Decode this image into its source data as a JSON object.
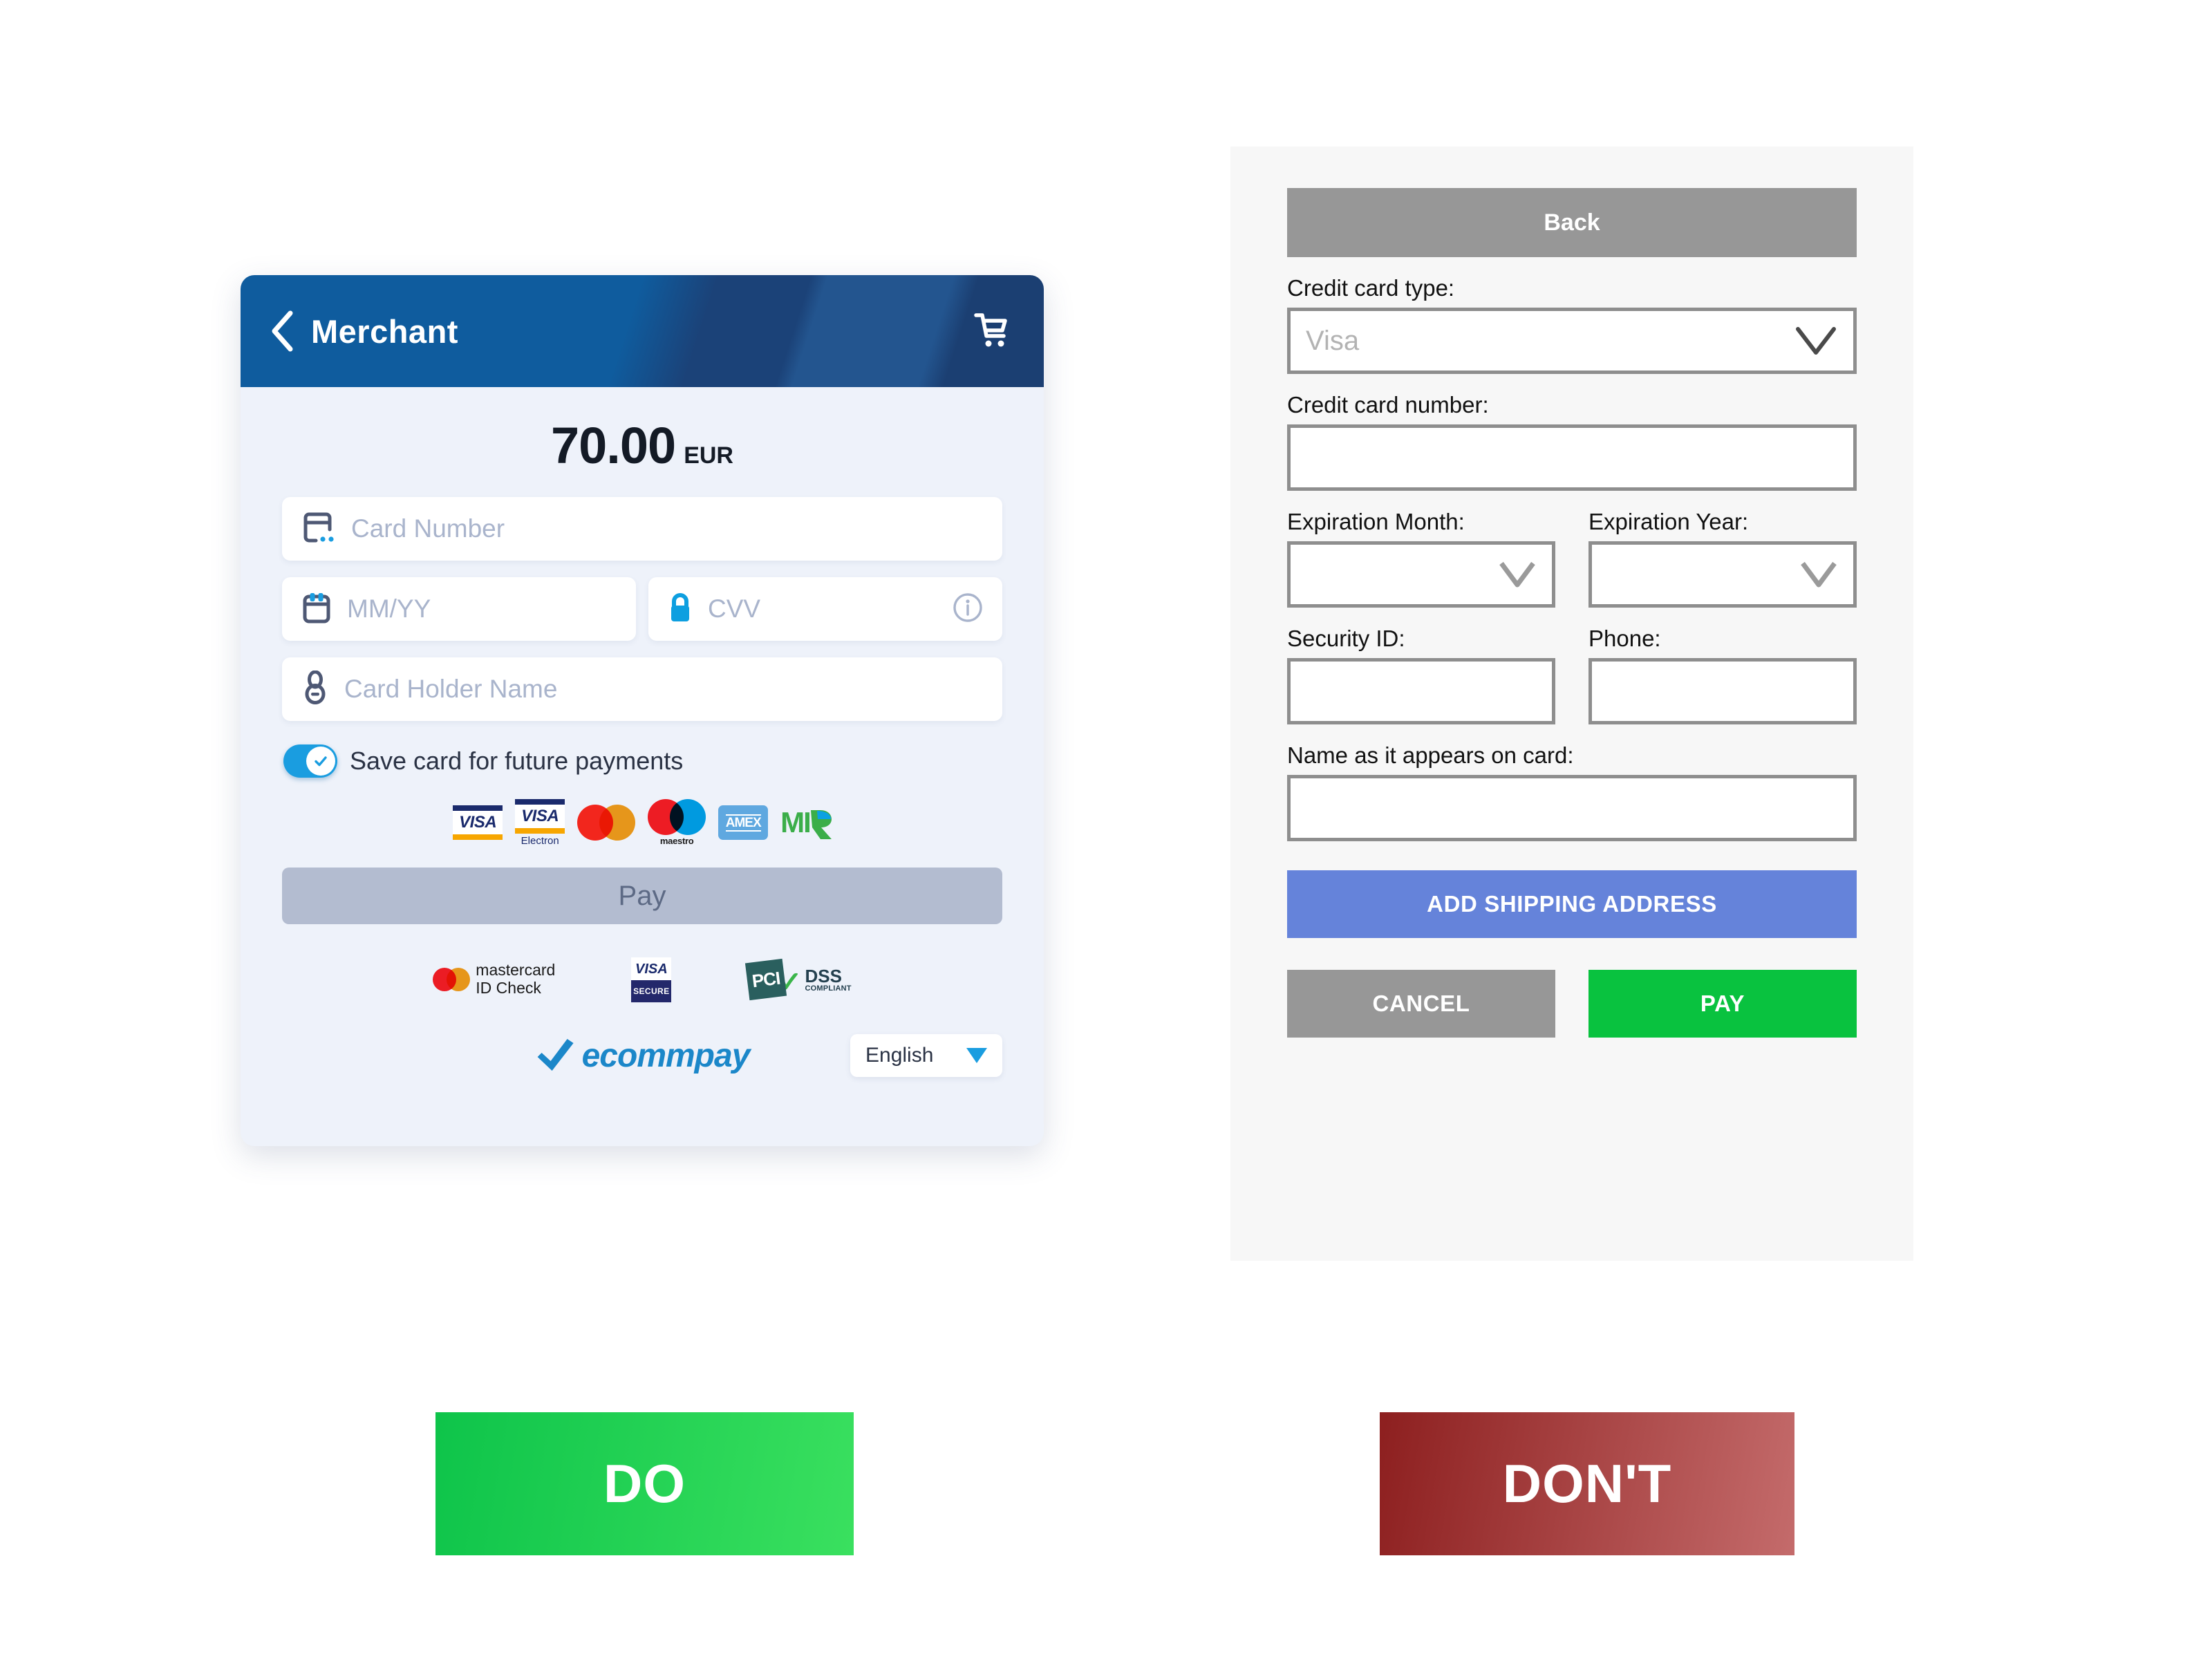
{
  "do_panel": {
    "header": {
      "back_icon": "chevron-left-icon",
      "merchant_title": "Merchant",
      "cart_icon": "shopping-cart-icon"
    },
    "amount": {
      "value": "70.00",
      "currency": "EUR"
    },
    "fields": [
      {
        "icon": "credit-card-icon",
        "placeholder": "Card Number",
        "value": ""
      },
      {
        "icon": "calendar-icon",
        "placeholder": "MM/YY",
        "value": ""
      },
      {
        "icon": "lock-icon",
        "placeholder": "CVV",
        "value": "",
        "trailing_icon": "info-circle-icon"
      },
      {
        "icon": "person-icon",
        "placeholder": "Card Holder Name",
        "value": ""
      }
    ],
    "save_card": {
      "label": "Save card for future payments",
      "checked": true,
      "check_icon": "check-icon"
    },
    "accepted_brands": [
      {
        "name": "visa-logo",
        "label": "VISA",
        "sub": ""
      },
      {
        "name": "visa-electron-logo",
        "label": "VISA",
        "sub": "Electron"
      },
      {
        "name": "mastercard-logo",
        "label": "",
        "sub": ""
      },
      {
        "name": "maestro-logo",
        "label": "",
        "sub": "maestro"
      },
      {
        "name": "amex-logo",
        "label": "AMEX",
        "sub": ""
      },
      {
        "name": "mir-logo",
        "label": "MI",
        "sub": ""
      }
    ],
    "pay_button_label": "Pay",
    "trust_badges": {
      "mastercard_idcheck_line1": "mastercard",
      "mastercard_idcheck_line2": "ID Check",
      "visa_secure_top": "VISA",
      "visa_secure_bottom": "SECURE",
      "pci_tile": "PCI",
      "pci_dss": "DSS",
      "pci_compliant": "COMPLIANT"
    },
    "footer": {
      "brand": "ecommpay",
      "brand_mark": "checkmark-logo-icon",
      "language_value": "English",
      "language_caret_icon": "caret-down-icon"
    }
  },
  "dont_panel": {
    "back_button_label": "Back",
    "fields": [
      {
        "label": "Credit card type:",
        "type": "select",
        "value": "Visa",
        "caret_icon": "chevron-down-icon"
      },
      {
        "label": "Credit card number:",
        "type": "text",
        "value": ""
      },
      {
        "label": "Expiration Month:",
        "type": "select",
        "value": "",
        "caret_icon": "chevron-down-icon"
      },
      {
        "label": "Expiration Year:",
        "type": "select",
        "value": "",
        "caret_icon": "chevron-down-icon"
      },
      {
        "label": "Security ID:",
        "type": "text",
        "value": ""
      },
      {
        "label": "Phone:",
        "type": "text",
        "value": ""
      },
      {
        "label": "Name as it appears on card:",
        "type": "text",
        "value": ""
      }
    ],
    "add_shipping_label": "ADD SHIPPING ADDRESS",
    "cancel_label": "CANCEL",
    "pay_label": "PAY"
  },
  "banners": {
    "do_label": "DO",
    "dont_label": "DON'T"
  },
  "colors": {
    "header_blue_left": "#0f5c9e",
    "header_blue_right": "#1b3f72",
    "card_bg": "#eef2fa",
    "accent_blue": "#1a9de0",
    "pay_disabled": "#b3bcd0",
    "dont_gray": "#979797",
    "dont_blue": "#6583da",
    "dont_green": "#09c23f",
    "banner_do": "#0ec44a",
    "banner_dont": "#8d1f1f"
  }
}
